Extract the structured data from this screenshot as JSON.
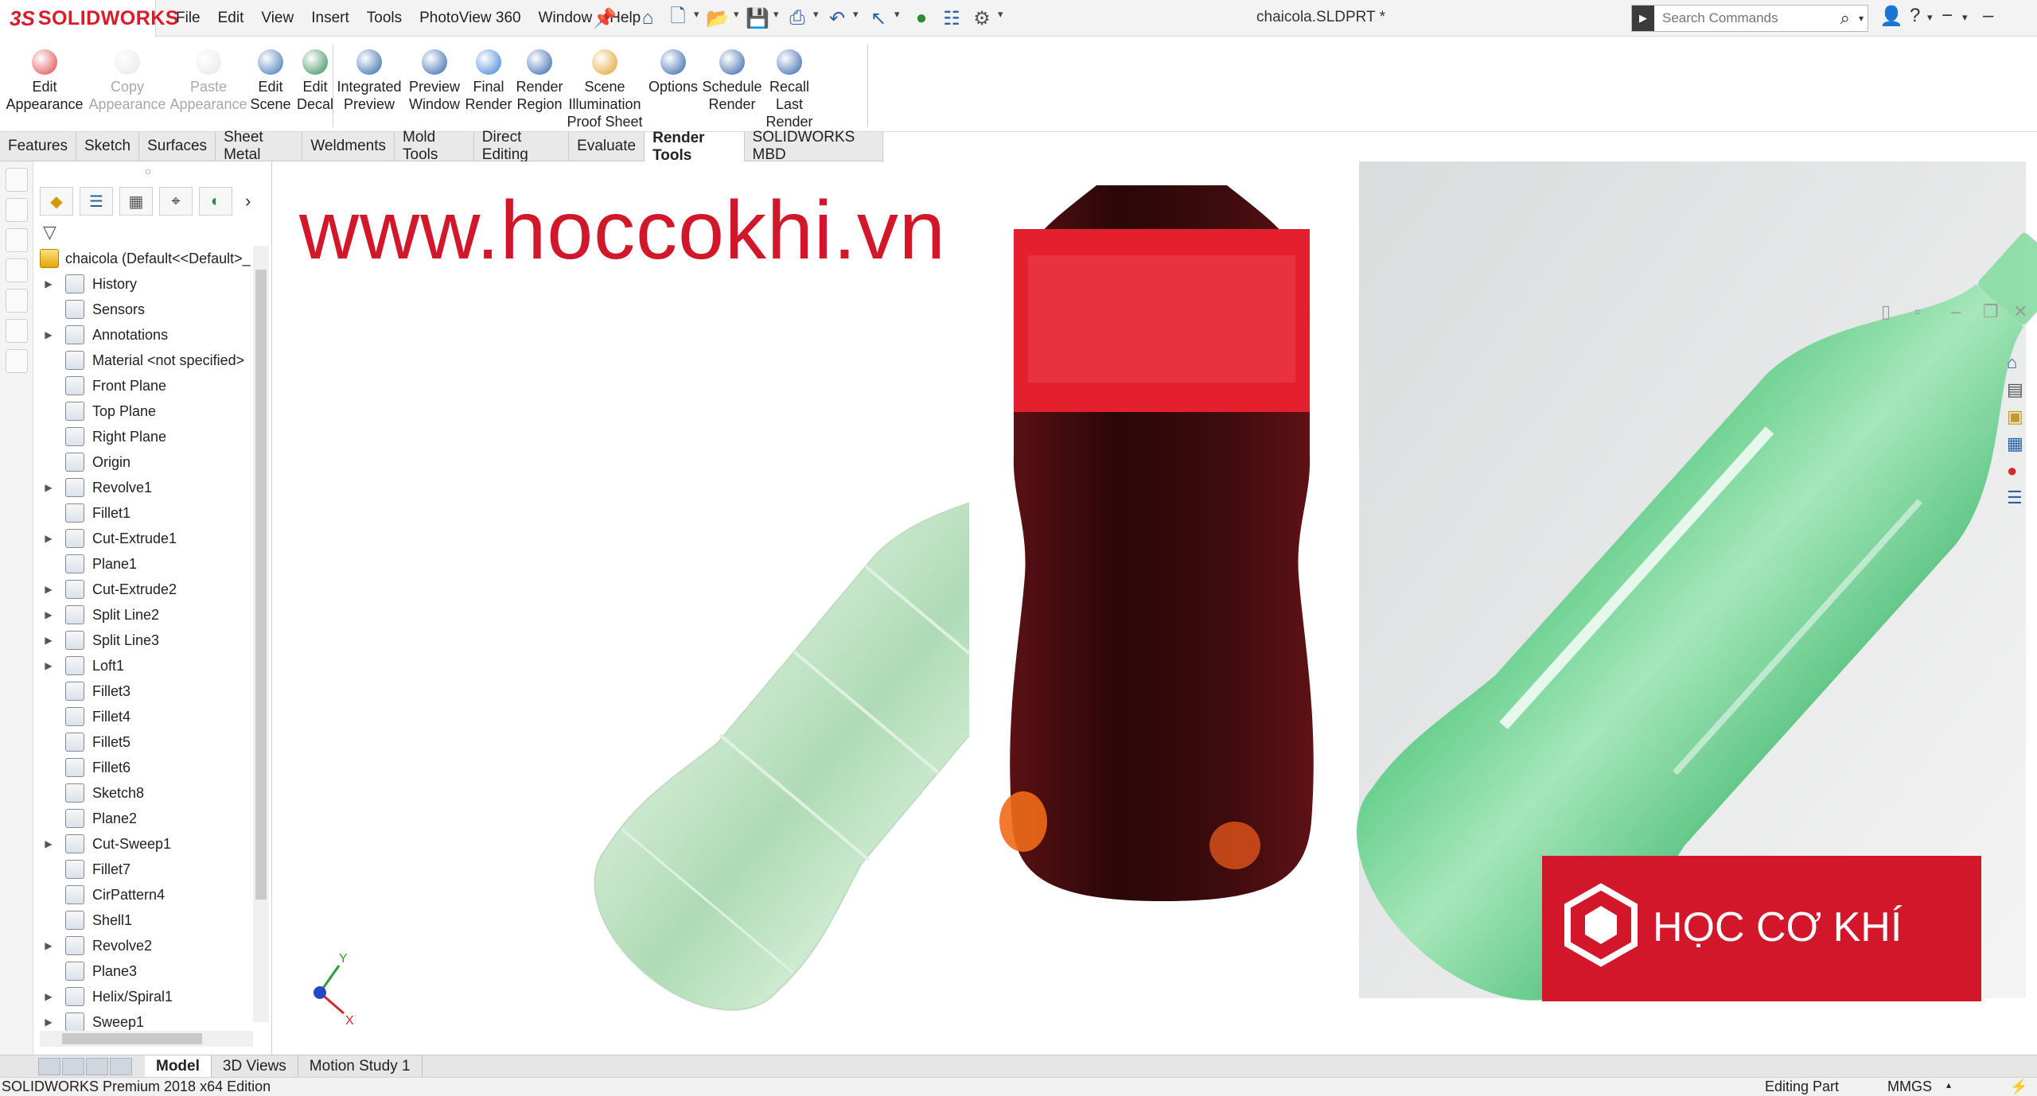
{
  "app": {
    "logo_prefix": "3S",
    "logo_text": "SOLIDWORKS",
    "document_title": "chaicola.SLDPRT *"
  },
  "menu": [
    "File",
    "Edit",
    "View",
    "Insert",
    "Tools",
    "PhotoView 360",
    "Window",
    "Help"
  ],
  "search": {
    "placeholder": "Search Commands"
  },
  "commands": [
    {
      "label": "Edit\nAppearance",
      "enabled": true,
      "icon": "edit-appearance-icon"
    },
    {
      "label": "Copy\nAppearance",
      "enabled": false,
      "icon": "copy-appearance-icon"
    },
    {
      "label": "Paste\nAppearance",
      "enabled": false,
      "icon": "paste-appearance-icon"
    },
    {
      "label": "Edit\nScene",
      "enabled": true,
      "icon": "edit-scene-icon"
    },
    {
      "label": "Edit\nDecal",
      "enabled": true,
      "icon": "edit-decal-icon"
    },
    {
      "label": "Integrated\nPreview",
      "enabled": true,
      "icon": "integrated-preview-icon"
    },
    {
      "label": "Preview\nWindow",
      "enabled": true,
      "icon": "preview-window-icon"
    },
    {
      "label": "Final\nRender",
      "enabled": true,
      "icon": "final-render-icon"
    },
    {
      "label": "Render\nRegion",
      "enabled": true,
      "icon": "render-region-icon"
    },
    {
      "label": "Scene\nIllumination\nProof Sheet",
      "enabled": true,
      "icon": "scene-illumination-icon"
    },
    {
      "label": "Options",
      "enabled": true,
      "icon": "options-icon"
    },
    {
      "label": "Schedule\nRender",
      "enabled": true,
      "icon": "schedule-render-icon"
    },
    {
      "label": "Recall\nLast\nRender",
      "enabled": true,
      "icon": "recall-last-render-icon"
    }
  ],
  "tabs": [
    "Features",
    "Sketch",
    "Surfaces",
    "Sheet Metal",
    "Weldments",
    "Mold Tools",
    "Direct Editing",
    "Evaluate",
    "Render Tools",
    "SOLIDWORKS MBD"
  ],
  "active_tab": "Render Tools",
  "tree": {
    "root": "chaicola  (Default<<Default>_",
    "items": [
      {
        "label": "History",
        "expandable": true,
        "icon": "history-icon"
      },
      {
        "label": "Sensors",
        "expandable": false,
        "icon": "sensors-icon"
      },
      {
        "label": "Annotations",
        "expandable": true,
        "icon": "annotations-icon"
      },
      {
        "label": "Material <not specified>",
        "expandable": false,
        "icon": "material-icon"
      },
      {
        "label": "Front Plane",
        "expandable": false,
        "icon": "plane-icon"
      },
      {
        "label": "Top Plane",
        "expandable": false,
        "icon": "plane-icon"
      },
      {
        "label": "Right Plane",
        "expandable": false,
        "icon": "plane-icon"
      },
      {
        "label": "Origin",
        "expandable": false,
        "icon": "origin-icon"
      },
      {
        "label": "Revolve1",
        "expandable": true,
        "icon": "revolve-icon"
      },
      {
        "label": "Fillet1",
        "expandable": false,
        "icon": "fillet-icon"
      },
      {
        "label": "Cut-Extrude1",
        "expandable": true,
        "icon": "cut-extrude-icon"
      },
      {
        "label": "Plane1",
        "expandable": false,
        "icon": "plane-icon"
      },
      {
        "label": "Cut-Extrude2",
        "expandable": true,
        "icon": "cut-extrude-icon"
      },
      {
        "label": "Split Line2",
        "expandable": true,
        "icon": "split-line-icon"
      },
      {
        "label": "Split Line3",
        "expandable": true,
        "icon": "split-line-icon"
      },
      {
        "label": "Loft1",
        "expandable": true,
        "icon": "loft-icon"
      },
      {
        "label": "Fillet3",
        "expandable": false,
        "icon": "fillet-icon"
      },
      {
        "label": "Fillet4",
        "expandable": false,
        "icon": "fillet-icon"
      },
      {
        "label": "Fillet5",
        "expandable": false,
        "icon": "fillet-icon"
      },
      {
        "label": "Fillet6",
        "expandable": false,
        "icon": "fillet-icon"
      },
      {
        "label": "Sketch8",
        "expandable": false,
        "icon": "sketch-icon"
      },
      {
        "label": "Plane2",
        "expandable": false,
        "icon": "plane-icon"
      },
      {
        "label": "Cut-Sweep1",
        "expandable": true,
        "icon": "cut-sweep-icon"
      },
      {
        "label": "Fillet7",
        "expandable": false,
        "icon": "fillet-icon"
      },
      {
        "label": "CirPattern4",
        "expandable": false,
        "icon": "circular-pattern-icon"
      },
      {
        "label": "Shell1",
        "expandable": false,
        "icon": "shell-icon"
      },
      {
        "label": "Revolve2",
        "expandable": true,
        "icon": "revolve-icon"
      },
      {
        "label": "Plane3",
        "expandable": false,
        "icon": "plane-icon"
      },
      {
        "label": "Helix/Spiral1",
        "expandable": true,
        "icon": "helix-icon"
      },
      {
        "label": "Sweep1",
        "expandable": true,
        "icon": "sweep-icon"
      }
    ]
  },
  "watermark": "www.hoccokhi.vn",
  "brand_logo_text": "HỌC CƠ KHÍ",
  "bottom_tabs": [
    "Model",
    "3D Views",
    "Motion Study 1"
  ],
  "active_bottom_tab": "Model",
  "status": {
    "edition": "SOLIDWORKS Premium 2018 x64 Edition",
    "mode": "Editing Part",
    "units": "MMGS"
  },
  "colors": {
    "brand_red": "#d3172b",
    "bottle_green": "#a6d9ae",
    "cola_dark": "#2b0b0c",
    "label_red": "#e5202e",
    "cap_red": "#e0283a"
  }
}
